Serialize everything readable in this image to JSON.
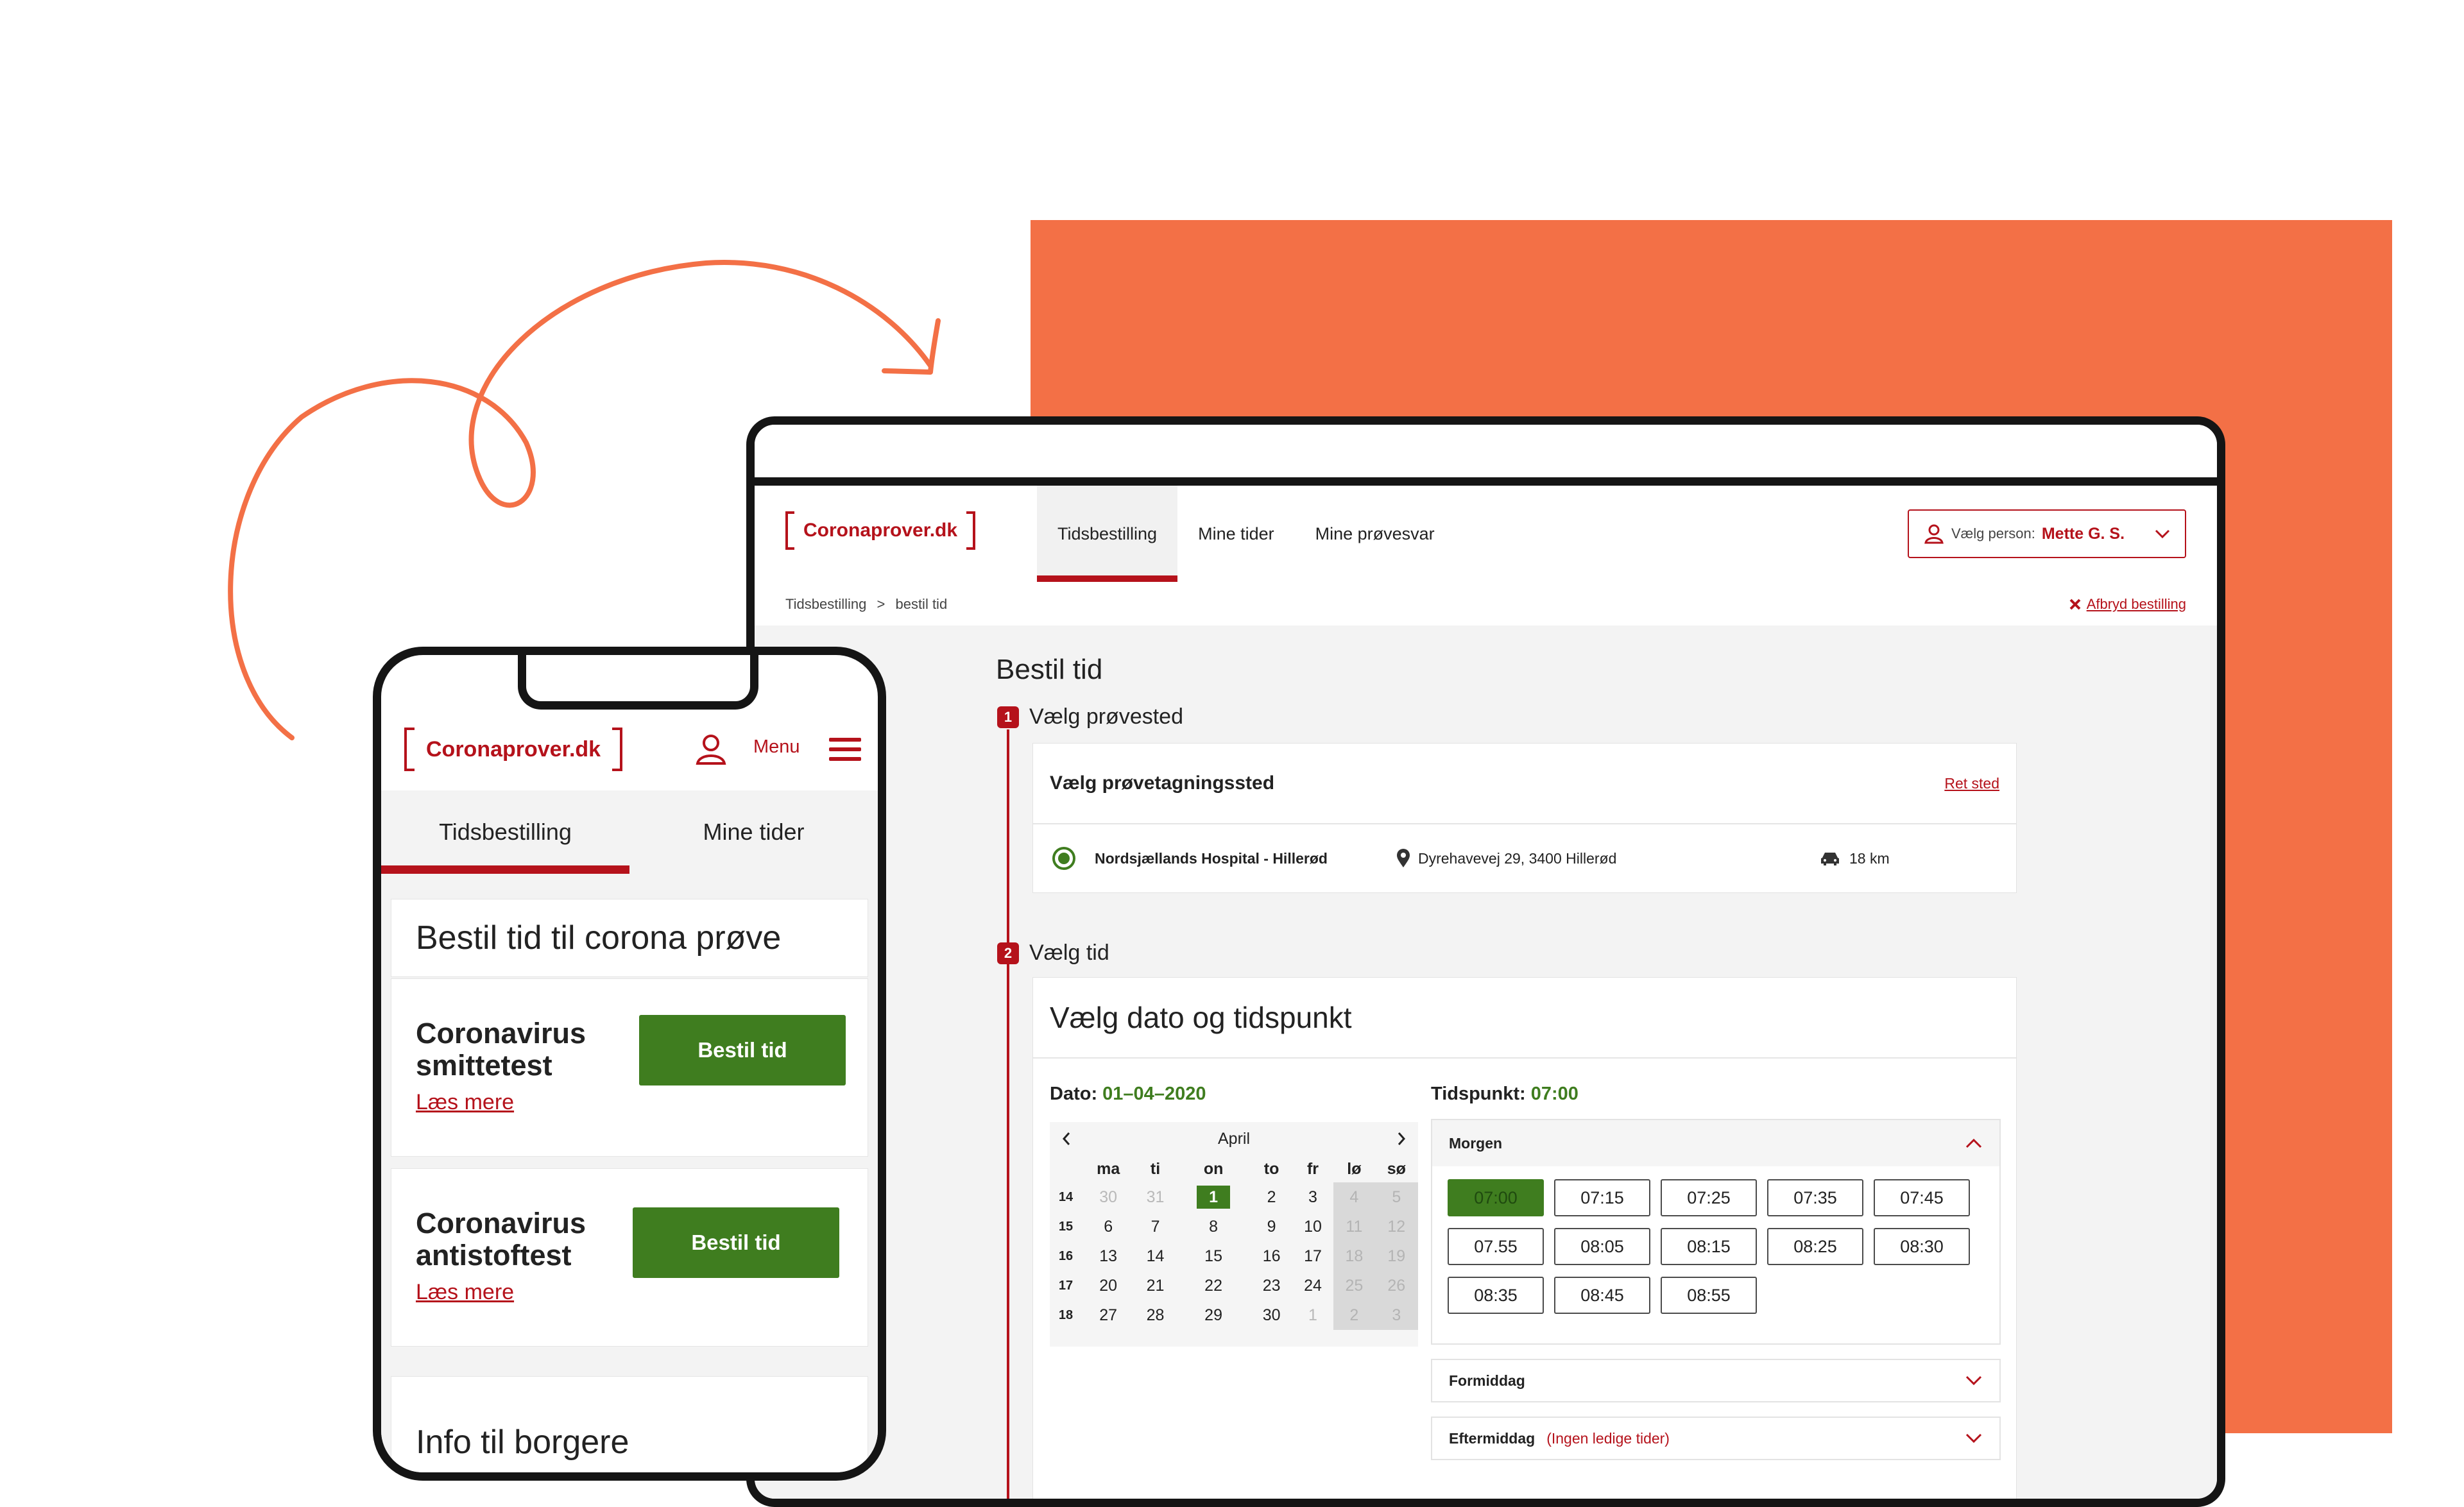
{
  "colors": {
    "brand_red": "#b5121b",
    "green": "#3f7d1f",
    "orange": "#f37046"
  },
  "desktop": {
    "logo": "Coronaprover.dk",
    "nav": [
      "Tidsbestilling",
      "Mine tider",
      "Mine prøvesvar"
    ],
    "person_label": "Vælg person:",
    "person_name": "Mette G. S.",
    "breadcrumb": [
      "Tidsbestilling",
      ">",
      "bestil tid"
    ],
    "cancel": "Afbryd bestilling",
    "page_title": "Bestil tid",
    "step1": {
      "num": "1",
      "label": "Vælg prøvested"
    },
    "location": {
      "head": "Vælg prøvetagningssted",
      "change": "Ret sted",
      "name": "Nordsjællands Hospital - Hillerød",
      "address": "Dyrehavevej 29, 3400 Hillerød",
      "distance": "18 km"
    },
    "step2": {
      "num": "2",
      "label": "Vælg tid"
    },
    "time_card_title": "Vælg dato og tidspunkt",
    "date_label": "Dato:",
    "date_value": "01–04–2020",
    "time_label": "Tidspunkt:",
    "time_value": "07:00",
    "calendar": {
      "month": "April",
      "weekdays": [
        "ma",
        "ti",
        "on",
        "to",
        "fr",
        "lø",
        "sø"
      ],
      "weeks": [
        {
          "wk": "14",
          "days": [
            "30",
            "31",
            "1",
            "2",
            "3",
            "4",
            "5"
          ]
        },
        {
          "wk": "15",
          "days": [
            "6",
            "7",
            "8",
            "9",
            "10",
            "11",
            "12"
          ]
        },
        {
          "wk": "16",
          "days": [
            "13",
            "14",
            "15",
            "16",
            "17",
            "18",
            "19"
          ]
        },
        {
          "wk": "17",
          "days": [
            "20",
            "21",
            "22",
            "23",
            "24",
            "25",
            "26"
          ]
        },
        {
          "wk": "18",
          "days": [
            "27",
            "28",
            "29",
            "30",
            "1",
            "2",
            "3"
          ]
        }
      ]
    },
    "morning": {
      "label": "Morgen",
      "slots": [
        "07:00",
        "07:15",
        "07:25",
        "07:35",
        "07:45",
        "07.55",
        "08:05",
        "08:15",
        "08:25",
        "08:30",
        "08:35",
        "08:45",
        "08:55"
      ]
    },
    "formiddag": "Formiddag",
    "eftermiddag": "Eftermiddag",
    "eftermiddag_note": "(Ingen ledige tider)"
  },
  "phone": {
    "logo": "Coronaprover.dk",
    "menu": "Menu",
    "tabs": [
      "Tidsbestilling",
      "Mine tider"
    ],
    "title": "Bestil tid til corona prøve",
    "tests": [
      {
        "name": "Coronavirus smittetest",
        "button": "Bestil tid",
        "link": "Læs mere"
      },
      {
        "name": "Coronavirus antistoftest",
        "button": "Bestil tid",
        "link": "Læs mere"
      }
    ],
    "info_title": "Info til borgere"
  }
}
